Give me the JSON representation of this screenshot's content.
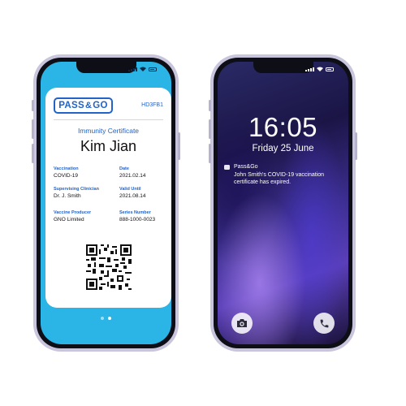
{
  "left_phone": {
    "card": {
      "logo_left": "PASS",
      "logo_amp": "&",
      "logo_right": "GO",
      "code": "HD3FB1",
      "title": "Immunity Certificate",
      "holder_name": "Kim Jian",
      "fields": [
        {
          "label": "Vaccination",
          "value": "COVID-19"
        },
        {
          "label": "Date",
          "value": "2021.02.14"
        },
        {
          "label": "Supervising Clinician",
          "value": "Dr. J. Smith"
        },
        {
          "label": "Valid Until",
          "value": "2021.08.14"
        },
        {
          "label": "Vaccine Producer",
          "value": "GNO Limited"
        },
        {
          "label": "Series Number",
          "value": "888-1000-0023"
        }
      ]
    },
    "page_indicator": {
      "total": 2,
      "active": 2
    }
  },
  "right_phone": {
    "time": "16:05",
    "date": "Friday 25 June",
    "notification": {
      "app_name": "Pass&Go",
      "message": "John Smith's COVID-19 vaccination certificate has expired."
    },
    "left_shortcut_icon": "camera-icon",
    "right_shortcut_icon": "phone-icon"
  },
  "colors": {
    "card_background": "#2bb5e6",
    "brand_blue": "#2163c9",
    "phone_frame": "#c9c5dc"
  }
}
